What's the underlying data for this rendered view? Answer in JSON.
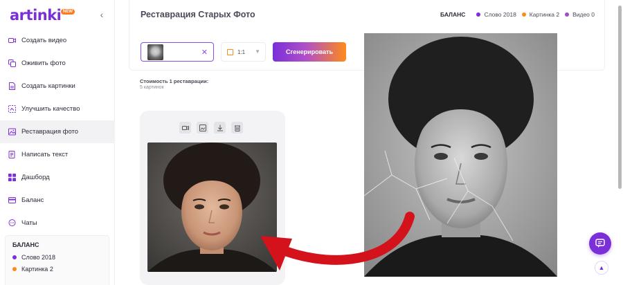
{
  "logo": {
    "text": "artinki",
    "badge": "NEW"
  },
  "colors": {
    "accent": "#7b2fd9",
    "orange": "#ff8a1a",
    "purple_dot": "#7b2fd9",
    "video_dot": "#9b4fc8"
  },
  "sidebar": {
    "items": [
      {
        "label": "Создать видео",
        "icon": "video-camera-icon"
      },
      {
        "label": "Оживить фото",
        "icon": "animate-photo-icon"
      },
      {
        "label": "Создать картинки",
        "icon": "document-image-icon"
      },
      {
        "label": "Улучшить качество",
        "icon": "enhance-quality-icon"
      },
      {
        "label": "Реставрация фото",
        "icon": "photo-restore-icon",
        "active": true
      },
      {
        "label": "Написать текст",
        "icon": "write-text-icon"
      },
      {
        "label": "Дашборд",
        "icon": "dashboard-grid-icon"
      },
      {
        "label": "Баланс",
        "icon": "wallet-card-icon"
      },
      {
        "label": "Чаты",
        "icon": "chat-bubble-icon"
      }
    ],
    "balance": {
      "title": "БАЛАНС",
      "rows": [
        {
          "label": "Слово 2018"
        },
        {
          "label": "Картинка 2"
        }
      ]
    }
  },
  "header": {
    "title": "Реставрация Старых Фото",
    "balance_label": "БАЛАНС",
    "balance_items": [
      {
        "label": "Слово 2018"
      },
      {
        "label": "Картинка 2"
      },
      {
        "label": "Видео 0"
      }
    ]
  },
  "controls": {
    "ratio_value": "1:1",
    "generate_label": "Сгенерировать"
  },
  "cost": {
    "title": "Стоимость 1 реставрации:",
    "subtitle": "5 картинок"
  }
}
